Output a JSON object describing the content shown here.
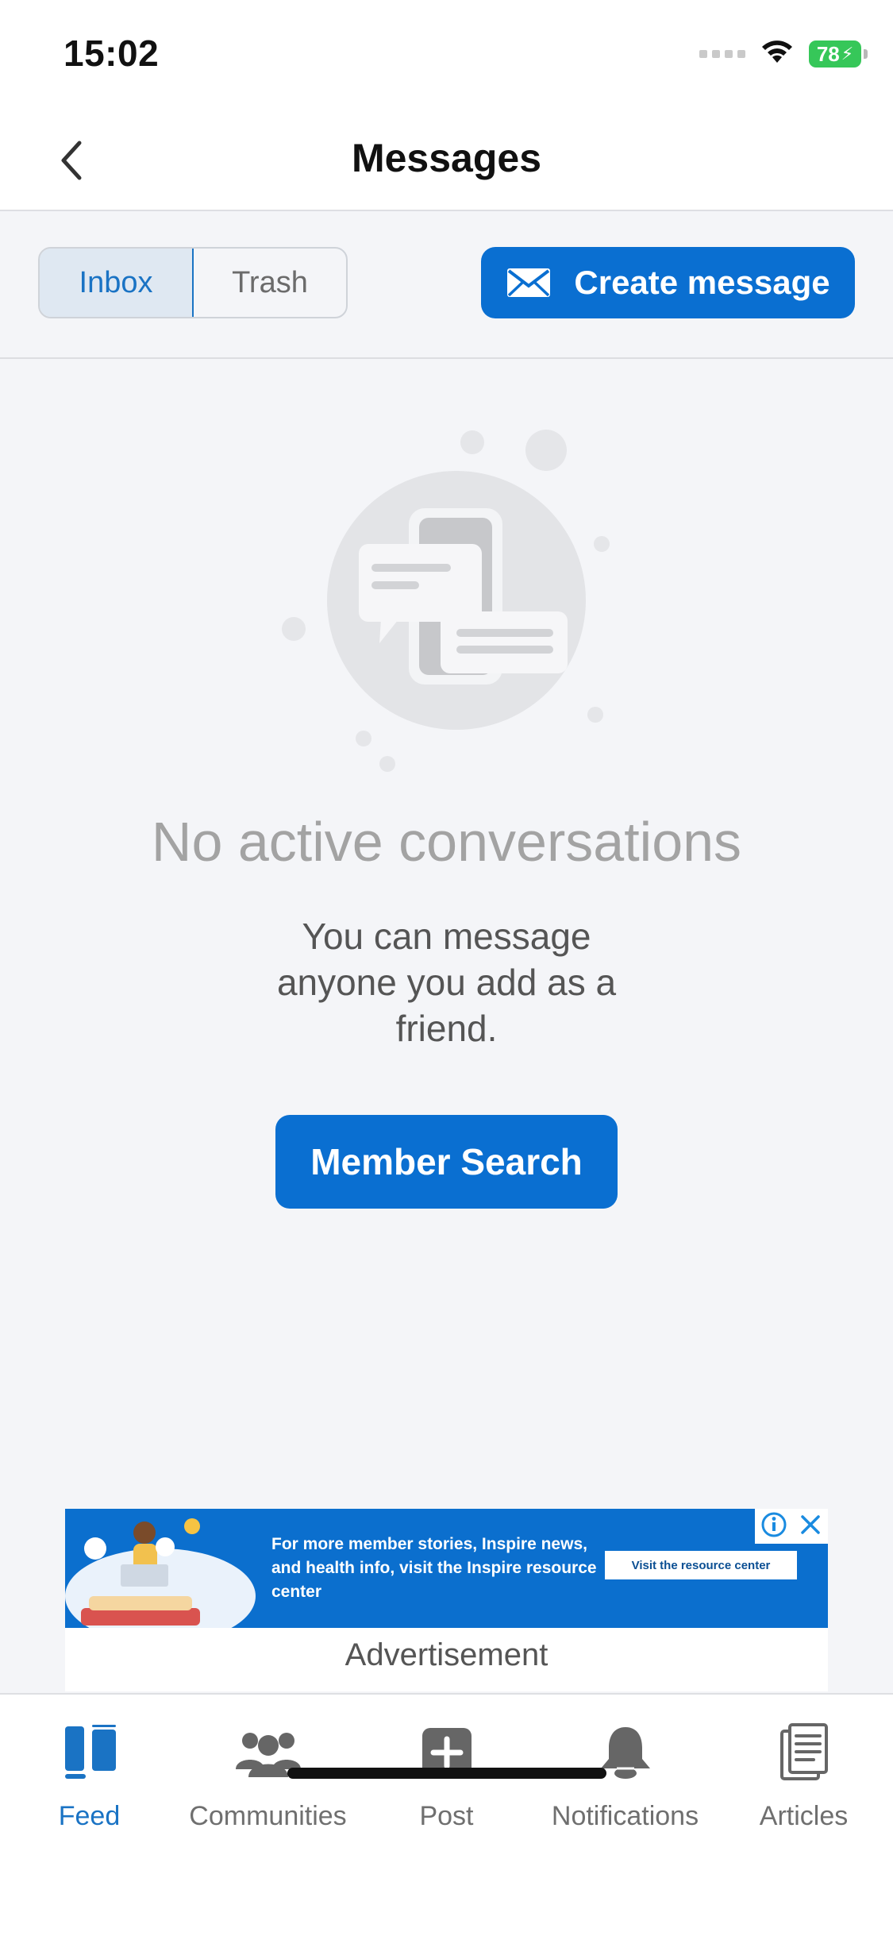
{
  "status_bar": {
    "time": "15:02",
    "battery": "78"
  },
  "header": {
    "title": "Messages",
    "back_icon": "chevron-left-icon"
  },
  "toolbar": {
    "tabs": [
      {
        "label": "Inbox",
        "active": true
      },
      {
        "label": "Trash",
        "active": false
      }
    ],
    "create_label": "Create message",
    "create_icon": "envelope-icon"
  },
  "empty_state": {
    "title": "No active conversations",
    "description": "You can message anyone you add as a friend.",
    "button_label": "Member Search"
  },
  "ad": {
    "text": "For more member stories, Inspire news, and health info, visit the Inspire resource center",
    "cta": "Visit the resource center",
    "label": "Advertisement"
  },
  "tabbar": {
    "items": [
      {
        "label": "Feed",
        "icon": "feed-icon",
        "active": true
      },
      {
        "label": "Communities",
        "icon": "people-icon",
        "active": false
      },
      {
        "label": "Post",
        "icon": "plus-square-icon",
        "active": false
      },
      {
        "label": "Notifications",
        "icon": "bell-icon",
        "active": false
      },
      {
        "label": "Articles",
        "icon": "document-icon",
        "active": false
      }
    ]
  },
  "colors": {
    "primary": "#0a6fd1",
    "active_tab": "#1a73c4",
    "background": "#f4f5f8",
    "battery": "#36c759"
  }
}
